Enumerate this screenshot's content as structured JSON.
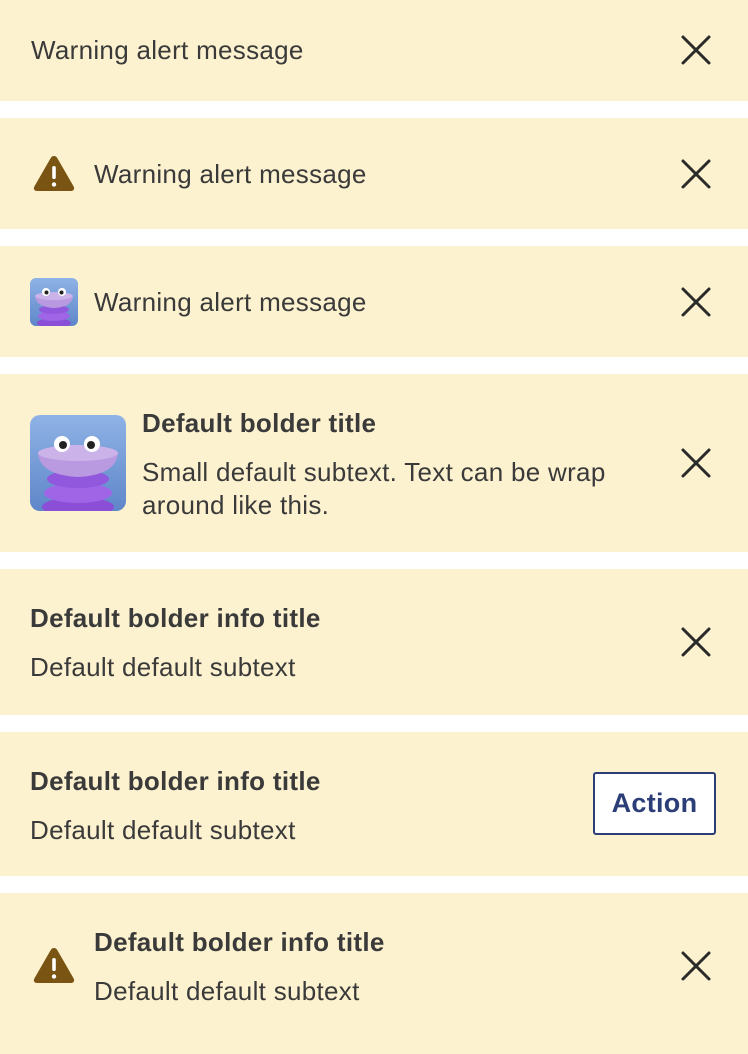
{
  "colors": {
    "alert_background": "#fdf2cf",
    "warning_icon": "#7a5412",
    "text": "#3a3a3a",
    "action_border": "#2c3e78"
  },
  "alerts": [
    {
      "variant": "text-only",
      "message": "Warning alert message",
      "dismiss_icon": "close-icon"
    },
    {
      "variant": "icon",
      "icon": "warning-triangle-icon",
      "message": "Warning alert message",
      "dismiss_icon": "close-icon"
    },
    {
      "variant": "thumbnail",
      "thumbnail": "purple-creature-avatar",
      "message": "Warning alert message",
      "dismiss_icon": "close-icon"
    },
    {
      "variant": "image-title-subtext",
      "thumbnail": "purple-creature-image",
      "title": "Default bolder title",
      "subtext": "Small default subtext. Text can be wrap around like this.",
      "dismiss_icon": "close-icon"
    },
    {
      "variant": "title-subtext",
      "title": "Default bolder info title",
      "subtext": "Default default subtext",
      "dismiss_icon": "close-icon"
    },
    {
      "variant": "title-subtext-action",
      "title": "Default bolder info title",
      "subtext": "Default default subtext",
      "action_label": "Action"
    },
    {
      "variant": "icon-title-subtext",
      "icon": "warning-triangle-icon",
      "title": "Default bolder info title",
      "subtext": "Default default subtext",
      "dismiss_icon": "close-icon"
    }
  ]
}
